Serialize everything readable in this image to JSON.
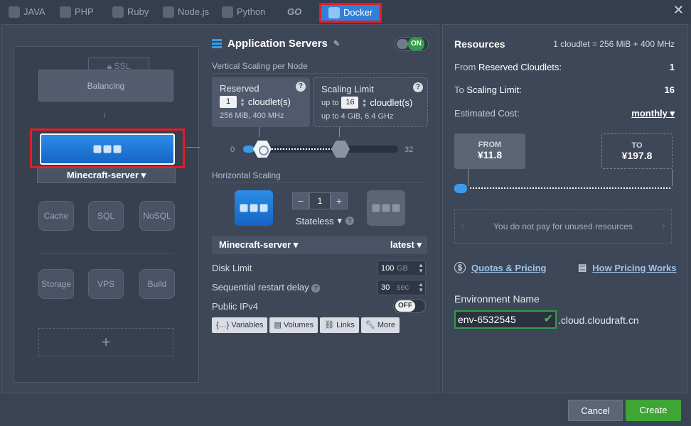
{
  "tabs": [
    {
      "label": "JAVA",
      "icon": "java-icon"
    },
    {
      "label": "PHP",
      "icon": "php-icon"
    },
    {
      "label": "Ruby",
      "icon": "ruby-icon"
    },
    {
      "label": "Node.js",
      "icon": "nodejs-icon"
    },
    {
      "label": "Python",
      "icon": "python-icon"
    },
    {
      "label": "GO",
      "icon": "go-icon"
    },
    {
      "label": "Docker",
      "icon": "docker-icon",
      "active": true
    }
  ],
  "topology": {
    "ssl": "SSL",
    "balancing": "Balancing",
    "node_name": "Minecraft-server",
    "databases": [
      "Cache",
      "SQL",
      "NoSQL"
    ],
    "extras": [
      "Storage",
      "VPS",
      "Build"
    ],
    "add": "+"
  },
  "app": {
    "title": "Application Servers",
    "toggle": "ON",
    "vertical_label": "Vertical Scaling per Node",
    "reserved": {
      "title": "Reserved",
      "value": "1",
      "unit": "cloudlet(s)",
      "sub": "256 MiB, 400 MHz"
    },
    "limit": {
      "title": "Scaling Limit",
      "upto": "up to",
      "value": "16",
      "unit": "cloudlet(s)",
      "sub_prefix": "up to",
      "sub": "4 GiB, 6.4 GHz"
    },
    "slider_min": "0",
    "slider_max": "32",
    "horizontal_label": "Horizontal Scaling",
    "node_count": "1",
    "minus": "−",
    "plus": "+",
    "stateless": "Stateless",
    "image": "Minecraft-server",
    "tag": "latest",
    "disk_label": "Disk Limit",
    "disk_value": "100",
    "disk_unit": "GB",
    "restart_label": "Sequential restart delay",
    "restart_value": "30",
    "restart_unit": "sec",
    "ipv4_label": "Public IPv4",
    "ipv4_toggle": "OFF",
    "buttons": [
      "Variables",
      "Volumes",
      "Links",
      "More"
    ]
  },
  "resources": {
    "title": "Resources",
    "ratio": "1 cloudlet = 256 MiB + 400 MHz",
    "reserved_prefix": "From",
    "reserved_label": "Reserved Cloudlets:",
    "reserved_value": "1",
    "limit_prefix": "To",
    "limit_label": "Scaling Limit:",
    "limit_value": "16",
    "cost_label": "Estimated Cost:",
    "cost_period": "monthly",
    "from_label": "FROM",
    "from_price": "¥11.8",
    "to_label": "TO",
    "to_price": "¥197.8",
    "info": "You do not pay for unused resources",
    "quotas_link": "Quotas & Pricing",
    "how_link": "How Pricing Works",
    "env_label": "Environment Name",
    "env_name": "env-6532545",
    "env_domain": ".cloud.cloudraft.cn"
  },
  "footer": {
    "cancel": "Cancel",
    "create": "Create"
  },
  "colors": {
    "accent": "#2f80d8",
    "highlight": "#e31d25",
    "success": "#3fa535"
  }
}
